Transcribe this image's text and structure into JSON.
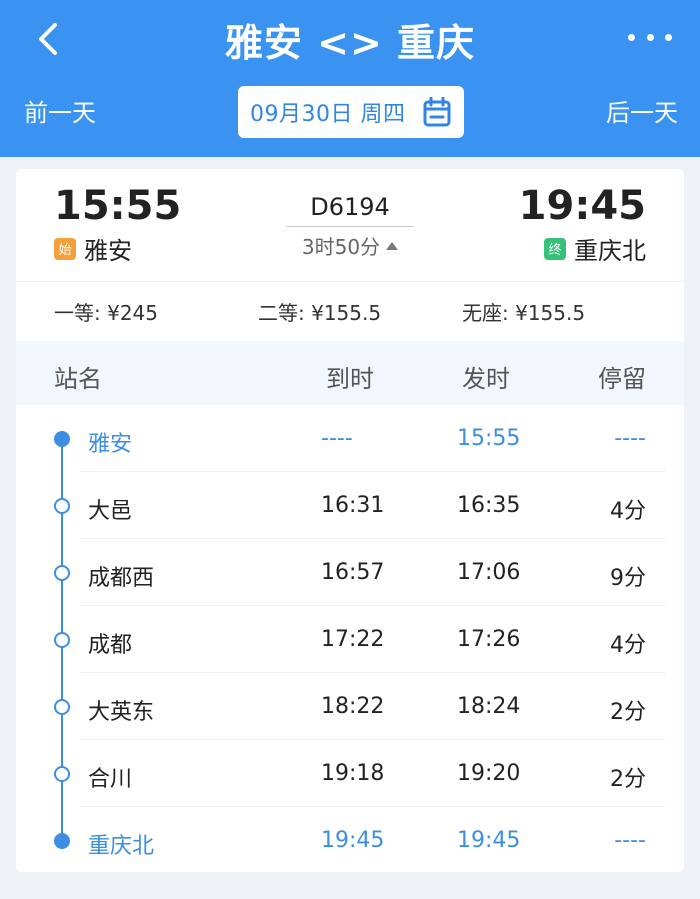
{
  "header": {
    "title": "雅安 <> 重庆",
    "prev_day": "前一天",
    "next_day": "后一天",
    "date": "09月30日 周四"
  },
  "train": {
    "number": "D6194",
    "duration": "3时50分",
    "departure": {
      "time": "15:55",
      "station": "雅安",
      "tag": "始"
    },
    "arrival": {
      "time": "19:45",
      "station": "重庆北",
      "tag": "终"
    }
  },
  "prices": [
    "一等: ¥245",
    "二等: ¥155.5",
    "无座: ¥155.5"
  ],
  "table": {
    "headers": [
      "站名",
      "到时",
      "发时",
      "停留"
    ],
    "rows": [
      {
        "name": "雅安",
        "arrive": "----",
        "depart": "15:55",
        "stop": "----"
      },
      {
        "name": "大邑",
        "arrive": "16:31",
        "depart": "16:35",
        "stop": "4分"
      },
      {
        "name": "成都西",
        "arrive": "16:57",
        "depart": "17:06",
        "stop": "9分"
      },
      {
        "name": "成都",
        "arrive": "17:22",
        "depart": "17:26",
        "stop": "4分"
      },
      {
        "name": "大英东",
        "arrive": "18:22",
        "depart": "18:24",
        "stop": "2分"
      },
      {
        "name": "合川",
        "arrive": "19:18",
        "depart": "19:20",
        "stop": "2分"
      },
      {
        "name": "重庆北",
        "arrive": "19:45",
        "depart": "19:45",
        "stop": "----"
      }
    ]
  },
  "colors": {
    "header_bg": "#3a93f0",
    "accent": "#3c8ee4",
    "start_tag": "#f5a03a",
    "end_tag": "#35c17a"
  },
  "icons": {
    "back": "chevron-left-icon",
    "more": "more-dots-icon",
    "calendar": "calendar-icon",
    "duration_toggle": "triangle-up-icon"
  }
}
